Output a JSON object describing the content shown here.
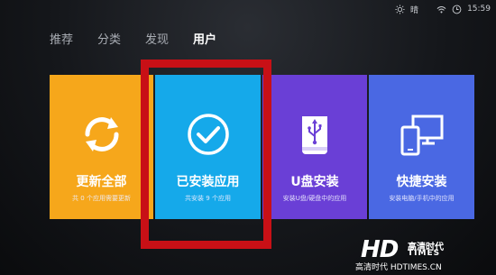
{
  "status": {
    "weather_label": "晴",
    "time": "15:59",
    "icons": [
      "weather-sun-icon",
      "wifi-icon",
      "clock-icon"
    ]
  },
  "nav": {
    "tabs": [
      {
        "label": "推荐",
        "active": false
      },
      {
        "label": "分类",
        "active": false
      },
      {
        "label": "发现",
        "active": false
      },
      {
        "label": "用户",
        "active": true
      }
    ]
  },
  "tiles": [
    {
      "title": "更新全部",
      "subtitle": "共 0 个应用需要更新",
      "icon": "refresh-icon",
      "color": "#f6a71b"
    },
    {
      "title": "已安装应用",
      "subtitle": "共安装 9 个应用",
      "icon": "checkmark-circle-icon",
      "color": "#15a9ea"
    },
    {
      "title": "U盘安装",
      "subtitle": "安装U盘/硬盘中的应用",
      "icon": "usb-drive-icon",
      "color": "#6a3fd6"
    },
    {
      "title": "快捷安装",
      "subtitle": "安装电脑/手机中的应用",
      "icon": "devices-icon",
      "color": "#4a68e3"
    }
  ],
  "highlight": {
    "color": "#c81016",
    "target": "已安装应用"
  },
  "watermark": {
    "logo": "HD",
    "cn_text": "高清时代",
    "en_text": "TIMES",
    "url": "高清时代 HDTIMES.CN"
  }
}
